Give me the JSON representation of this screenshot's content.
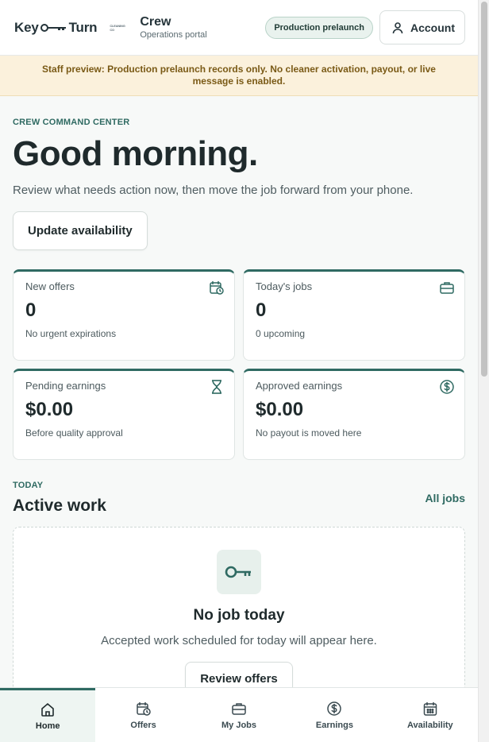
{
  "header": {
    "logo_left": "Key",
    "logo_right": "Turn",
    "logo_sub": "CLEANING CO",
    "portal_title": "Crew",
    "portal_subtitle": "Operations portal",
    "env_pill": "Production prelaunch",
    "account_label": "Account"
  },
  "banner": {
    "text": "Staff preview: Production prelaunch records only. No cleaner activation, payout, or live message is enabled."
  },
  "hero": {
    "eyebrow": "CREW COMMAND CENTER",
    "greeting": "Good morning.",
    "lead": "Review what needs action now, then move the job forward from your phone.",
    "primary_button": "Update availability"
  },
  "stats": [
    {
      "label": "New offers",
      "value": "0",
      "note": "No urgent expirations",
      "icon": "calendar-clock-icon"
    },
    {
      "label": "Today's jobs",
      "value": "0",
      "note": "0 upcoming",
      "icon": "briefcase-icon"
    },
    {
      "label": "Pending earnings",
      "value": "$0.00",
      "note": "Before quality approval",
      "icon": "hourglass-icon"
    },
    {
      "label": "Approved earnings",
      "value": "$0.00",
      "note": "No payout is moved here",
      "icon": "dollar-circle-icon"
    }
  ],
  "active_work": {
    "eyebrow": "TODAY",
    "title": "Active work",
    "link": "All jobs",
    "empty_title": "No job today",
    "empty_desc": "Accepted work scheduled for today will appear here.",
    "empty_button": "Review offers"
  },
  "bottom_nav": [
    {
      "label": "Home",
      "icon": "home-icon",
      "active": true
    },
    {
      "label": "Offers",
      "icon": "calendar-clock-icon"
    },
    {
      "label": "My Jobs",
      "icon": "briefcase-icon"
    },
    {
      "label": "Earnings",
      "icon": "dollar-circle-icon"
    },
    {
      "label": "Availability",
      "icon": "calendar-icon"
    }
  ],
  "colors": {
    "accent": "#2f6a62",
    "banner_bg": "#fbf1dc",
    "banner_text": "#7a5a16"
  }
}
